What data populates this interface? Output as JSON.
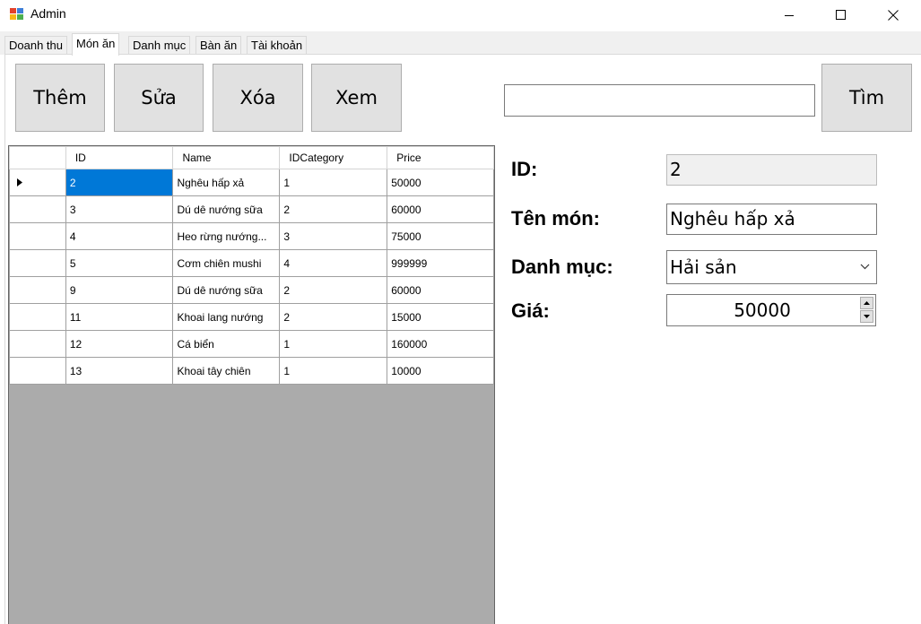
{
  "window": {
    "title": "Admin",
    "icon_colors": [
      "#e3412b",
      "#3d7ed8",
      "#f7b717",
      "#4caf50"
    ]
  },
  "tabs": [
    {
      "label": "Doanh thu",
      "active": false
    },
    {
      "label": "Món ăn",
      "active": true
    },
    {
      "label": "Danh mục",
      "active": false
    },
    {
      "label": "Bàn ăn",
      "active": false
    },
    {
      "label": "Tài khoản",
      "active": false
    }
  ],
  "toolbar": {
    "add_label": "Thêm",
    "edit_label": "Sửa",
    "delete_label": "Xóa",
    "view_label": "Xem",
    "search_value": "",
    "search_button_label": "Tìm"
  },
  "grid": {
    "columns": [
      "ID",
      "Name",
      "IDCategory",
      "Price"
    ],
    "rows": [
      {
        "id": "2",
        "name": "Nghêu hấp xả",
        "idcategory": "1",
        "price": "50000",
        "selected": true
      },
      {
        "id": "3",
        "name": "Dú dê nướng sữa",
        "idcategory": "2",
        "price": "60000"
      },
      {
        "id": "4",
        "name": "Heo rừng nướng...",
        "idcategory": "3",
        "price": "75000"
      },
      {
        "id": "5",
        "name": "Cơm chiên mushi",
        "idcategory": "4",
        "price": "999999"
      },
      {
        "id": "9",
        "name": "Dú dê nướng sữa",
        "idcategory": "2",
        "price": "60000"
      },
      {
        "id": "11",
        "name": "Khoai lang nướng",
        "idcategory": "2",
        "price": "15000"
      },
      {
        "id": "12",
        "name": "Cá biển",
        "idcategory": "1",
        "price": "160000"
      },
      {
        "id": "13",
        "name": "Khoai tây chiên",
        "idcategory": "1",
        "price": "10000"
      }
    ],
    "selected_color": "#0078d7"
  },
  "details": {
    "id_label": "ID:",
    "id_value": "2",
    "name_label": "Tên món:",
    "name_value": "Nghêu hấp xả",
    "category_label": "Danh mục:",
    "category_value": "Hải sản",
    "price_label": "Giá:",
    "price_value": "50000"
  }
}
